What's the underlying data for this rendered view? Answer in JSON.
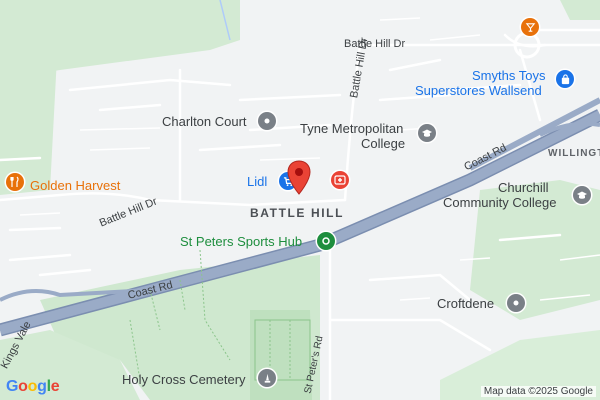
{
  "map": {
    "area_label": "BATTLE HILL",
    "secondary_area_label": "WILLINGTO",
    "roads": {
      "coast_rd_1": "Coast Rd",
      "coast_rd_2": "Coast Rd",
      "battle_hill_dr_1": "Battle Hill Dr",
      "battle_hill_dr_2": "Battle Hill Dr",
      "battle_hill_dr_3": "Battle Hill Dr",
      "kings_vale": "Kings Vale",
      "st_peters_rd": "St Peter's Rd"
    },
    "places": {
      "lidl": "Lidl",
      "charlton_court": "Charlton Court",
      "tyne_met_line1": "Tyne Metropolitan",
      "tyne_met_line2": "College",
      "smyths_line1": "Smyths Toys",
      "smyths_line2": "Superstores Wallsend",
      "churchill_line1": "Churchill",
      "churchill_line2": "Community College",
      "golden_harvest": "Golden Harvest",
      "st_peters_sports": "St Peters Sports Hub",
      "croftdene": "Croftdene",
      "holy_cross": "Holy Cross Cemetery"
    },
    "icons": {
      "pin": "red-location-pin",
      "lidl": "shopping-cart-icon",
      "hospital": "medical-cross-icon",
      "school": "graduation-cap-icon",
      "landmark": "place-pin-icon",
      "restaurant": "fork-knife-icon",
      "bar": "cocktail-icon",
      "shopping": "shopping-bag-icon",
      "park": "park-dot-icon",
      "cemetery": "monument-icon"
    },
    "colors": {
      "pin": "#ea4335",
      "shop": "#1a73e8",
      "park": "#1e8e3e",
      "food": "#e8710a",
      "landmark": "#5f6368",
      "motorway": "#8d9fbd"
    }
  },
  "branding": {
    "logo": "Google",
    "attribution": "Map data ©2025 Google"
  }
}
